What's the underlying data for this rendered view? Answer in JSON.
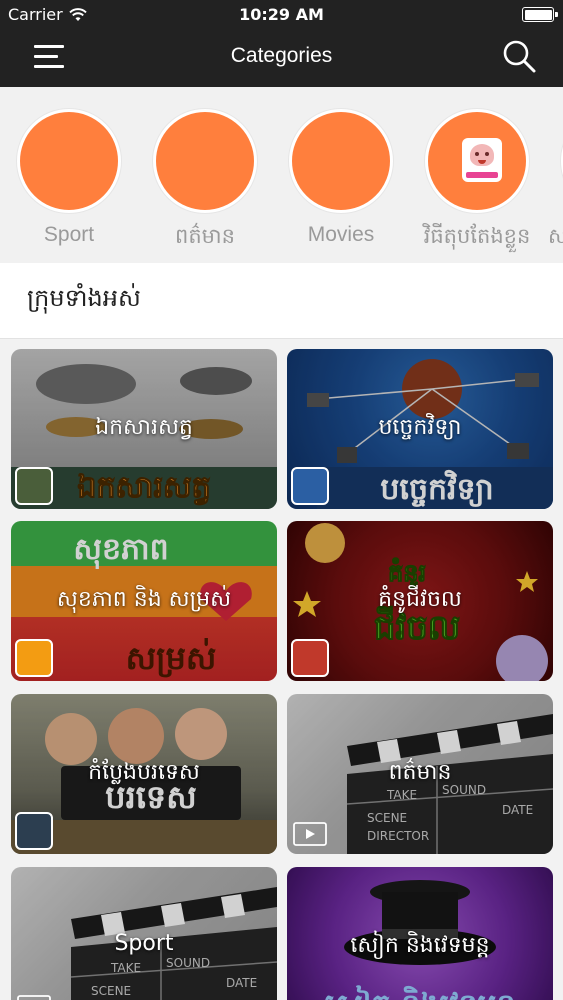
{
  "status_bar": {
    "carrier": "Carrier",
    "time": "10:29 AM"
  },
  "nav": {
    "title": "Categories"
  },
  "categories": [
    {
      "label": "Sport"
    },
    {
      "label": "ពត៌មាន"
    },
    {
      "label": "Movies"
    },
    {
      "label": "វិធីតុបតែងខ្លួន"
    },
    {
      "label": "ស"
    }
  ],
  "section": {
    "title": "ក្រុមទាំងអស់"
  },
  "tiles": [
    {
      "label": "ឯកសារសត្វ"
    },
    {
      "label": "បច្ចេកវិទ្យា"
    },
    {
      "label": "សុខភាព និង សម្រស់"
    },
    {
      "label": "គំនូជីវចល"
    },
    {
      "label": "កំប្លែងបរទេស"
    },
    {
      "label": "ពត៌មាន"
    },
    {
      "label": "Sport"
    },
    {
      "label": "សៀក និងវេទមន្ត"
    }
  ],
  "colors": {
    "header_bg": "#222222",
    "category_circle": "#ff7f3d",
    "category_label": "#9a9a9a"
  },
  "icons": {
    "menu": "hamburger-icon",
    "search": "search-icon",
    "wifi": "wifi-icon",
    "battery": "battery-icon",
    "video": "video-camera-icon"
  }
}
